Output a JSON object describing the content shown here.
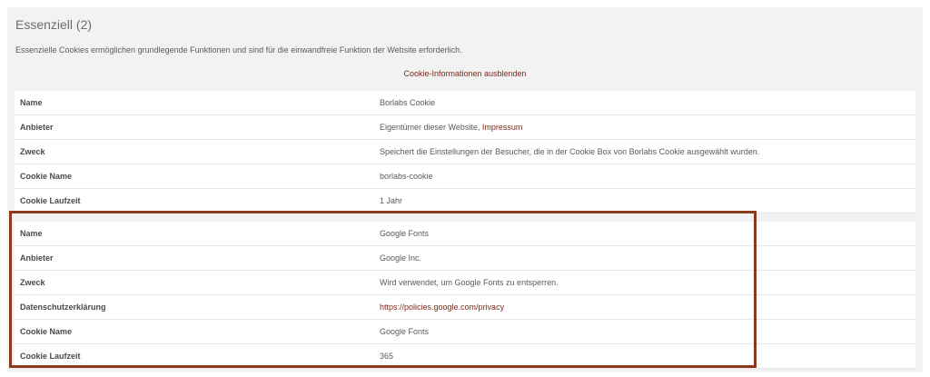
{
  "section": {
    "title": "Essenziell (2)",
    "description": "Essenzielle Cookies ermöglichen grundlegende Funktionen und sind für die einwandfreie Funktion der Website erforderlich.",
    "toggle_link": "Cookie-Informationen ausblenden"
  },
  "cookies": [
    {
      "name_label": "Name",
      "name": "Borlabs Cookie",
      "provider_label": "Anbieter",
      "provider": "Eigentümer dieser Website,",
      "provider_link": "Impressum",
      "purpose_label": "Zweck",
      "purpose": "Speichert die Einstellungen der Besucher, die in der Cookie Box von Borlabs Cookie ausgewählt wurden.",
      "cookie_name_label": "Cookie Name",
      "cookie_name": "borlabs-cookie",
      "lifetime_label": "Cookie Laufzeit",
      "lifetime": "1 Jahr"
    },
    {
      "name_label": "Name",
      "name": "Google Fonts",
      "provider_label": "Anbieter",
      "provider": "Google Inc.",
      "purpose_label": "Zweck",
      "purpose": "Wird verwendet, um Google Fonts zu entsperren.",
      "privacy_label": "Datenschutzerklärung",
      "privacy": "https://policies.google.com/privacy",
      "cookie_name_label": "Cookie Name",
      "cookie_name": "Google Fonts",
      "lifetime_label": "Cookie Laufzeit",
      "lifetime": "365"
    }
  ],
  "colors": {
    "link": "#7a2a1a",
    "highlight_border": "#8b3a1e",
    "panel_background": "#f2f2f2"
  }
}
